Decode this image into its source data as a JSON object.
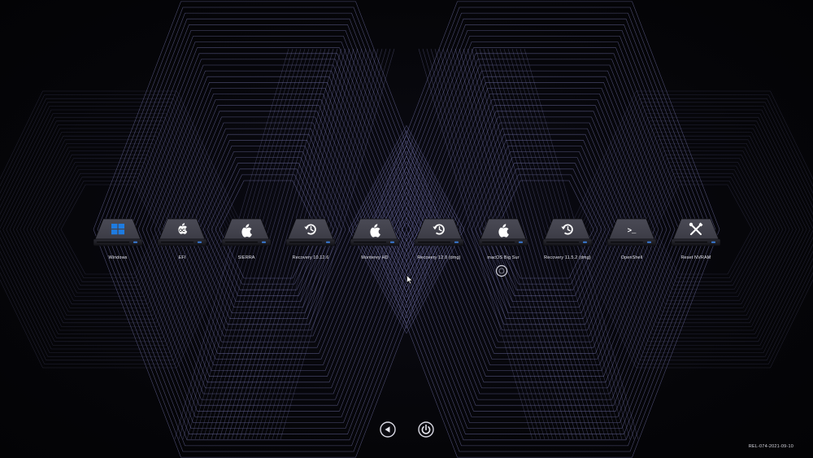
{
  "boot_entries": [
    {
      "label": "Windows",
      "icon": "windows-icon",
      "accent": "#1e7be0"
    },
    {
      "label": "EFI",
      "icon": "efi-icon"
    },
    {
      "label": "SIERRA",
      "icon": "apple-icon"
    },
    {
      "label": "Recovery 10.12.6",
      "icon": "recovery-icon"
    },
    {
      "label": "Monterey HD",
      "icon": "apple-icon"
    },
    {
      "label": "Recovery 12.0 (dmg)",
      "icon": "recovery-icon"
    },
    {
      "label": "macOS Big Sur",
      "icon": "apple-icon",
      "selected": true
    },
    {
      "label": "Recovery 11.5.2 (dmg)",
      "icon": "recovery-icon"
    },
    {
      "label": "OpenShell",
      "icon": "terminal-icon"
    },
    {
      "label": "Reset NVRAM",
      "icon": "tools-icon"
    }
  ],
  "toolbar": {
    "back_icon": "back-arrow-icon",
    "power_icon": "power-icon"
  },
  "version": "REL-074-2021-09-10",
  "colors": {
    "background": "#05050a",
    "line": "#8c8cd0",
    "drive_top": "#3c3c46",
    "drive_dark": "#121217",
    "led": "#3a7bd5",
    "label": "#e6e6ee"
  }
}
